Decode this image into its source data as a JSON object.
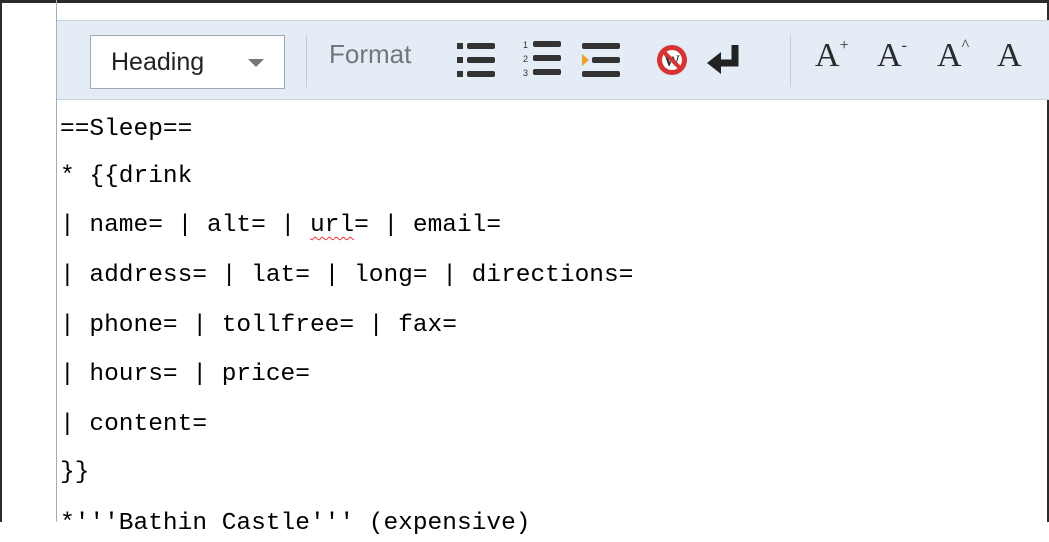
{
  "toolbar": {
    "heading_select": "Heading",
    "format_label": "Format",
    "icons": [
      "bulleted-list-icon",
      "numbered-list-icon",
      "indent-icon",
      "no-wiki-icon",
      "newline-icon",
      "big-font-icon",
      "small-font-icon",
      "superscript-icon",
      "subscript-icon"
    ],
    "font_buttons": [
      "A",
      "A",
      "A",
      "A"
    ]
  },
  "editor": {
    "lines": [
      "==Sleep==",
      "* {{drink",
      "| name= | alt= | url= | email=",
      "| address= | lat= | long= | directions=",
      "| phone= | tollfree= | fax=",
      "| hours= | price=",
      "| content=",
      "}}",
      "*'''Bathin Castle''' (expensive)"
    ],
    "misspelled_word": "url"
  },
  "colors": {
    "toolbar_bg": "#e4edf5",
    "no_wiki_red": "#d73333",
    "indent_orange": "#f0a030",
    "spellcheck_red": "#e8333a"
  }
}
